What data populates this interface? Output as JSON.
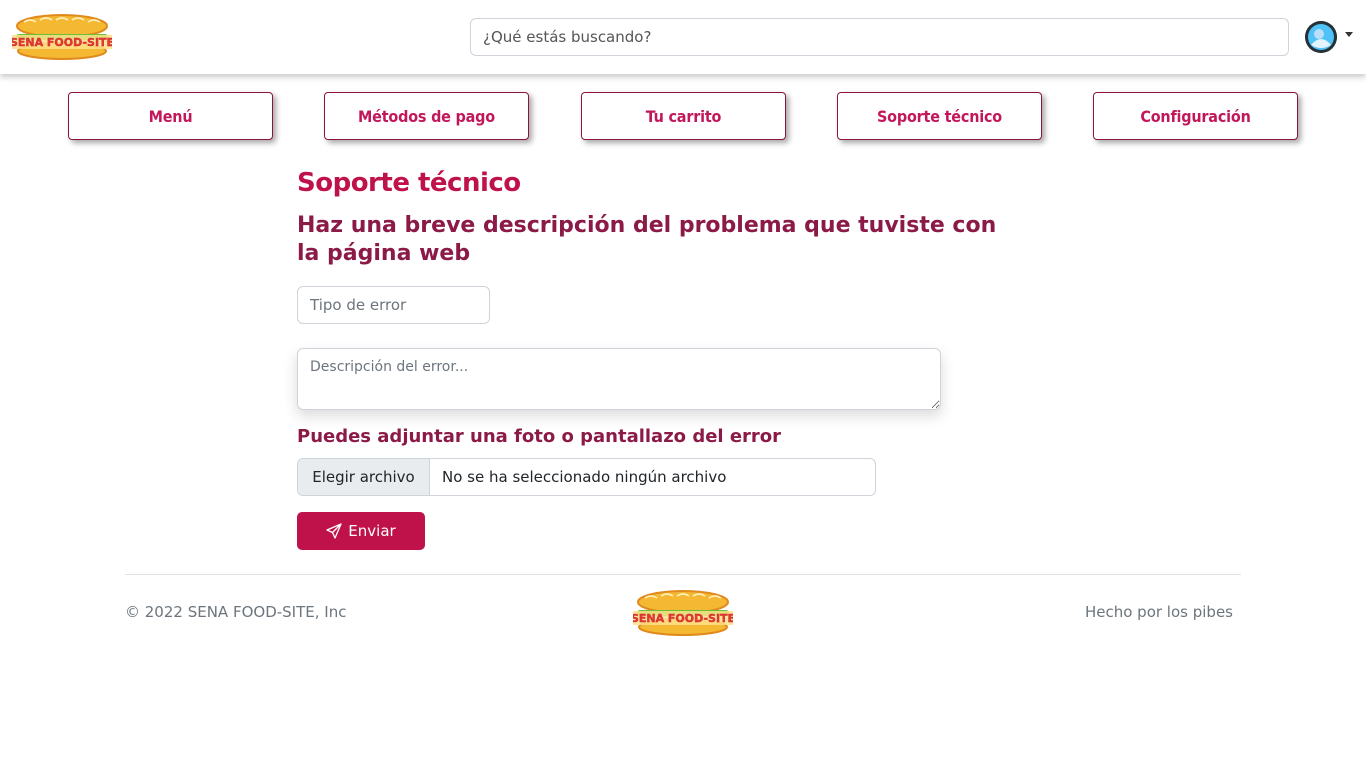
{
  "brand": {
    "logo_text": "SENA FOOD-SITE"
  },
  "search": {
    "placeholder": "¿Qué estás buscando?"
  },
  "nav": {
    "items": [
      {
        "label": "Menú"
      },
      {
        "label": "Métodos de pago"
      },
      {
        "label": "Tu carrito"
      },
      {
        "label": "Soporte técnico"
      },
      {
        "label": "Configuración"
      }
    ]
  },
  "main": {
    "title": "Soporte técnico",
    "subtitle": "Haz una breve descripción del problema que tuviste con la página web",
    "error_type_placeholder": "Tipo de error",
    "description_placeholder": "Descripción del error...",
    "attach_label": "Puedes adjuntar una foto o pantallazo del error",
    "file_button": "Elegir archivo",
    "file_status": "No se ha seleccionado ningún archivo",
    "send_label": "Enviar"
  },
  "footer": {
    "copyright": "© 2022 SENA FOOD-SITE, Inc",
    "made_by": "Hecho por los pibes"
  },
  "colors": {
    "accent": "#c0124a",
    "subtitle": "#8b1a47",
    "nav_border": "#8b1538"
  },
  "icons": {
    "avatar": "user-avatar",
    "send": "paper-plane-icon",
    "caret": "chevron-down-icon"
  }
}
